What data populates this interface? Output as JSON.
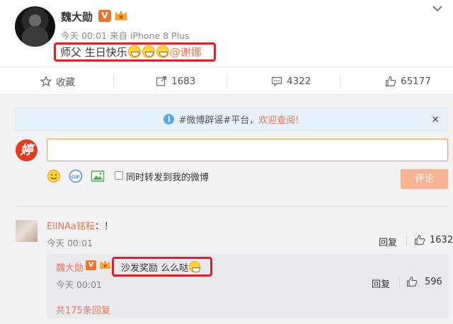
{
  "post": {
    "author": "魏大勋",
    "verified_badge": "V",
    "meta": "今天 00:01 来自 iPhone 8 Plus",
    "content_text": "师父 生日快乐",
    "mention": "@谢娜"
  },
  "actions": {
    "favorite": "收藏",
    "repost_count": "1683",
    "comment_count": "4322",
    "like_count": "65177"
  },
  "notice": {
    "prefix": "#微博辟谣#平台，",
    "link": "欢迎查阅!",
    "close": "×"
  },
  "composer": {
    "avatar_char": "婷",
    "input_value": "",
    "repost_label": "同时转发到我的微博",
    "submit": "评论"
  },
  "comment": {
    "user": "EllNAa铭耘",
    "text": "：！",
    "time": "今天 00:01",
    "reply_label": "回复",
    "likes": "1632",
    "reply": {
      "user": "魏大勋",
      "text": "沙发奖励 么么哒",
      "time": "今天 00:01",
      "reply_label": "回复",
      "likes": "596"
    },
    "total_replies": "共175条回复"
  },
  "colors": {
    "accent": "#eb7350",
    "highlight_border": "#e3202a",
    "badge": "#e9762a",
    "submit_bg": "#f7b393"
  }
}
